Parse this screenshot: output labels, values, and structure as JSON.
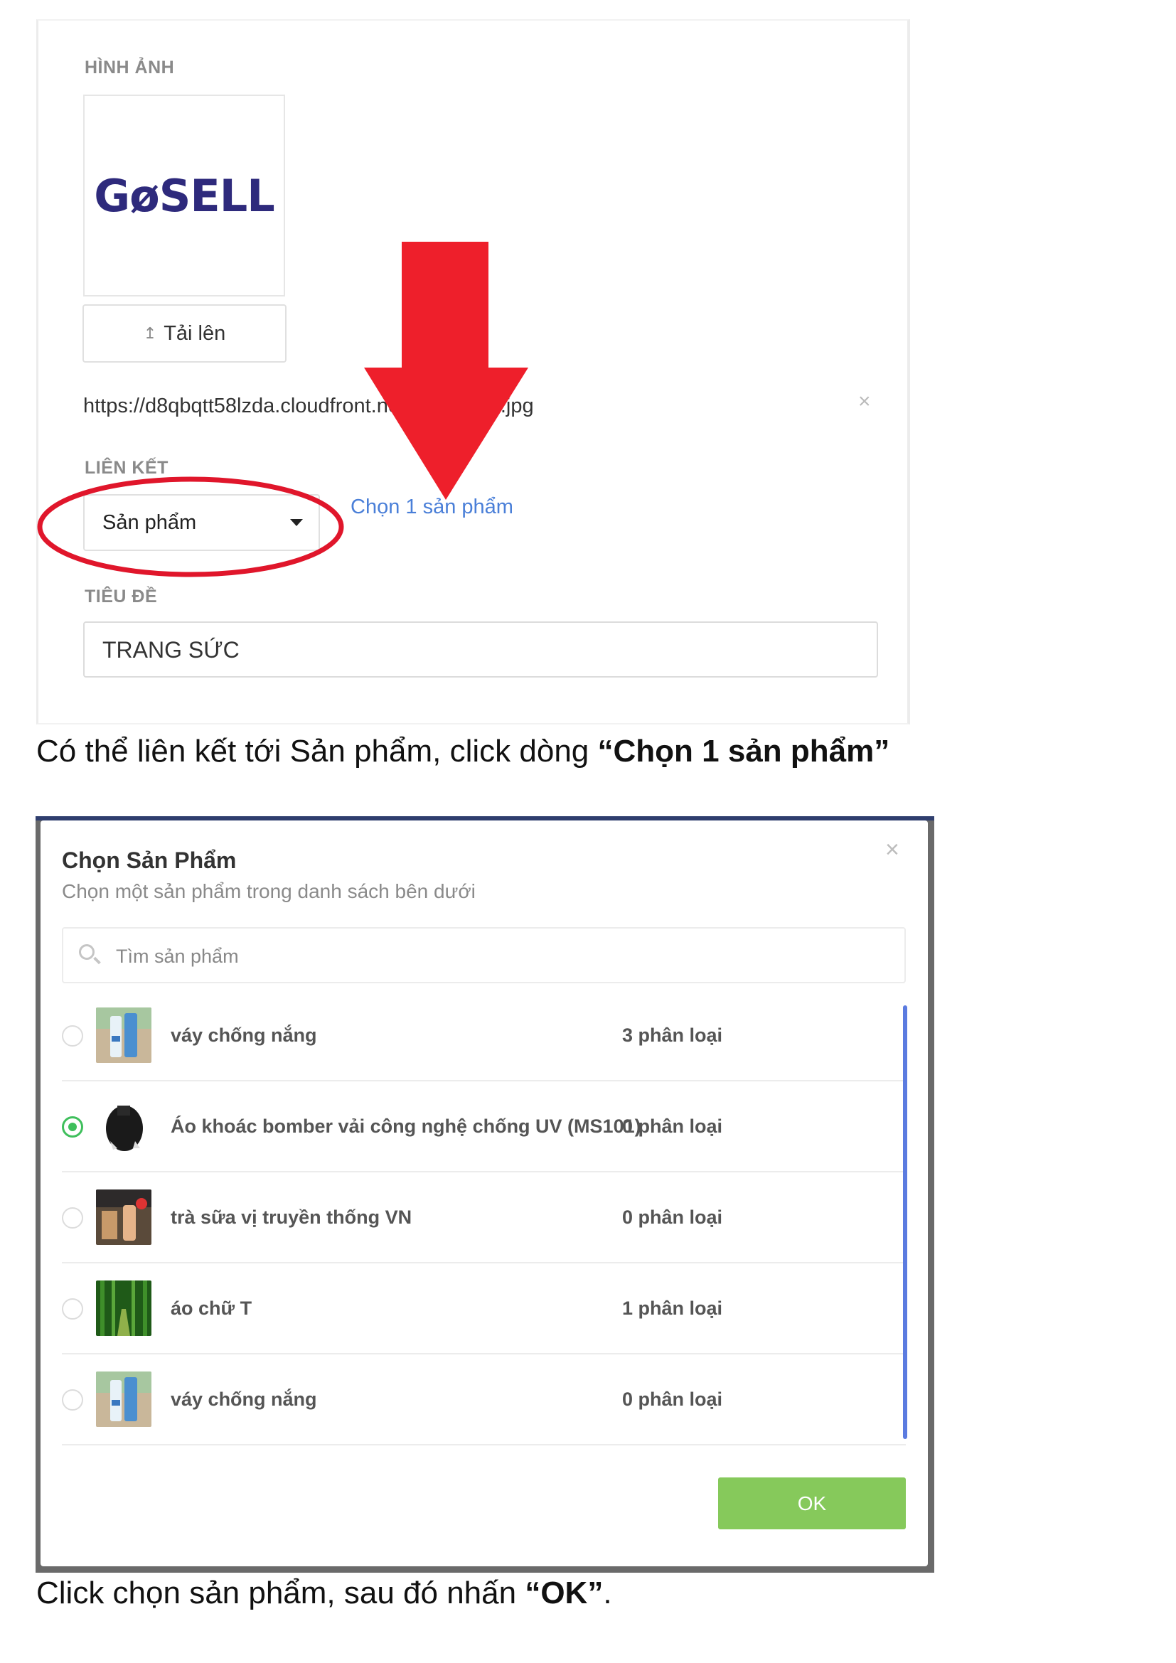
{
  "step1": {
    "image_label": "HÌNH ẢNH",
    "logo_text": "GøSELL",
    "upload_label": "Tải lên",
    "url_text": "https://d8qbqtt58lzda.cloudfront.net/…650042.jpg",
    "link_label": "LIÊN KẾT",
    "link_select_value": "Sản phẩm",
    "choose_product_link": "Chọn 1 sản phẩm",
    "title_label": "TIÊU ĐỀ",
    "title_value": "TRANG SỨC",
    "caption_prefix": "Có thể liên kết tới Sản phẩm,  click dòng ",
    "caption_bold": "“Chọn 1 sản phẩm”",
    "annotation_arrow_color": "#ee1f2b",
    "annotation_ellipse_color": "#e0162b"
  },
  "step2": {
    "modal_title": "Chọn Sản Phẩm",
    "modal_subtitle": "Chọn một sản phẩm trong danh sách bên dưới",
    "search_placeholder": "Tìm sản phẩm",
    "products": [
      {
        "name": "váy chống nắng",
        "variants": "3 phân loại",
        "selected": false,
        "thumb": "sunscreen"
      },
      {
        "name": "Áo khoác bomber vải công nghệ chống UV (MS101)",
        "variants": "0 phân loại",
        "selected": true,
        "thumb": "jacket"
      },
      {
        "name": "trà sữa vị truyền thống VN",
        "variants": "0 phân loại",
        "selected": false,
        "thumb": "milk-tea"
      },
      {
        "name": "áo chữ T",
        "variants": "1 phân loại",
        "selected": false,
        "thumb": "bamboo"
      },
      {
        "name": "váy chống nắng",
        "variants": "0 phân loại",
        "selected": false,
        "thumb": "sunscreen"
      }
    ],
    "ok_label": "OK",
    "caption_prefix": "Click chọn sản phẩm, sau đó nhấn ",
    "caption_bold": "“OK”",
    "caption_suffix": "."
  }
}
